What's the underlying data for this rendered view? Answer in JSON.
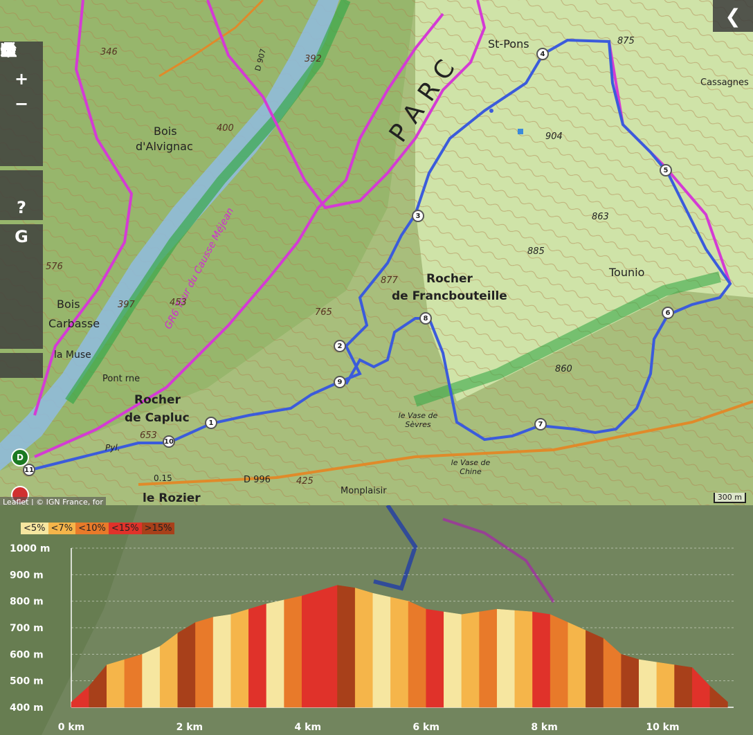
{
  "map": {
    "labels": {
      "bois_alvignac_1": "Bois",
      "bois_alvignac_2": "d'Alvignac",
      "bois_carbasse_1": "Bois",
      "bois_carbasse_2": "Carbasse",
      "la_muse": "la Muse",
      "pont_rne": "Pont rne",
      "rocher_capluc_1": "Rocher",
      "rocher_capluc_2": "de Capluc",
      "rocher_francbouteille_1": "Rocher",
      "rocher_francbouteille_2": "de Francbouteille",
      "tounio": "Tounio",
      "st_pons": "St-Pons",
      "cassagnes": "Cassagnes",
      "le_rozier": "le Rozier",
      "monplaisir": "Monplaisir",
      "vase_sevres": "le Vase de Sèvres",
      "vase_chine": "le Vase de Chine",
      "pyl": "Pyl.",
      "parc": "PARC",
      "tour_causse": "GR6 Tour du Causse Méjean",
      "d996": "D 996",
      "d907": "D 907",
      "alt_346": "346",
      "alt_392": "392",
      "alt_400": "400",
      "alt_576": "576",
      "alt_397": "397",
      "alt_453": "453",
      "alt_653": "653",
      "alt_765": "765",
      "alt_877": "877",
      "alt_904": "904",
      "alt_863": "863",
      "alt_885": "885",
      "alt_860": "860",
      "alt_875": "875",
      "alt_860b": "860",
      "alt_425": "425",
      "alt_015": "0.15"
    },
    "waypoints": [
      "1",
      "2",
      "3",
      "4",
      "5",
      "6",
      "7",
      "8",
      "9",
      "10",
      "11"
    ],
    "start_marker": "D",
    "attribution": "Leaflet | © IGN France, for",
    "scale": "300 m",
    "route_color": "#3b5bdb",
    "trail_color": "#d43bd4"
  },
  "toolbar": {
    "search_icon": "search-icon",
    "zoom_in": "+",
    "zoom_out": "−",
    "print_icon": "print-icon",
    "help": "?",
    "google": "G",
    "collapse": "❮"
  },
  "profile": {
    "legend": [
      "<5%",
      "<7%",
      "<10%",
      "<15%",
      ">15%"
    ],
    "legend_colors": [
      "#f6e6a0",
      "#f5b54a",
      "#e87a2a",
      "#e0322a",
      "#a8401a"
    ]
  },
  "chart_data": {
    "type": "area",
    "title": "",
    "xlabel": "",
    "ylabel": "",
    "x_ticks": [
      "0 km",
      "2 km",
      "4 km",
      "6 km",
      "8 km",
      "10 km"
    ],
    "y_ticks": [
      "400 m",
      "500 m",
      "600 m",
      "700 m",
      "800 m",
      "900 m",
      "1000 m"
    ],
    "xlim": [
      0,
      11.2
    ],
    "ylim": [
      400,
      1000
    ],
    "x": [
      0,
      0.3,
      0.6,
      0.9,
      1.2,
      1.5,
      1.8,
      2.1,
      2.4,
      2.7,
      3.0,
      3.3,
      3.6,
      3.9,
      4.2,
      4.5,
      4.8,
      5.1,
      5.4,
      5.7,
      6.0,
      6.3,
      6.6,
      6.9,
      7.2,
      7.5,
      7.8,
      8.1,
      8.4,
      8.7,
      9.0,
      9.3,
      9.6,
      9.9,
      10.2,
      10.5,
      10.8,
      11.1
    ],
    "y": [
      420,
      480,
      560,
      580,
      600,
      630,
      680,
      720,
      740,
      750,
      770,
      790,
      805,
      820,
      840,
      860,
      850,
      830,
      815,
      800,
      770,
      760,
      750,
      760,
      770,
      765,
      760,
      750,
      720,
      690,
      660,
      600,
      580,
      570,
      560,
      550,
      480,
      420
    ],
    "grade_classes": [
      3,
      4,
      1,
      2,
      0,
      1,
      4,
      2,
      0,
      1,
      3,
      0,
      2,
      3,
      3,
      4,
      1,
      0,
      1,
      2,
      3,
      0,
      1,
      2,
      0,
      1,
      3,
      2,
      1,
      4,
      2,
      4,
      0,
      1,
      4,
      3,
      4,
      2
    ],
    "legend": [
      "<5%",
      "<7%",
      "<10%",
      "<15%",
      ">15%"
    ],
    "grid": true
  }
}
